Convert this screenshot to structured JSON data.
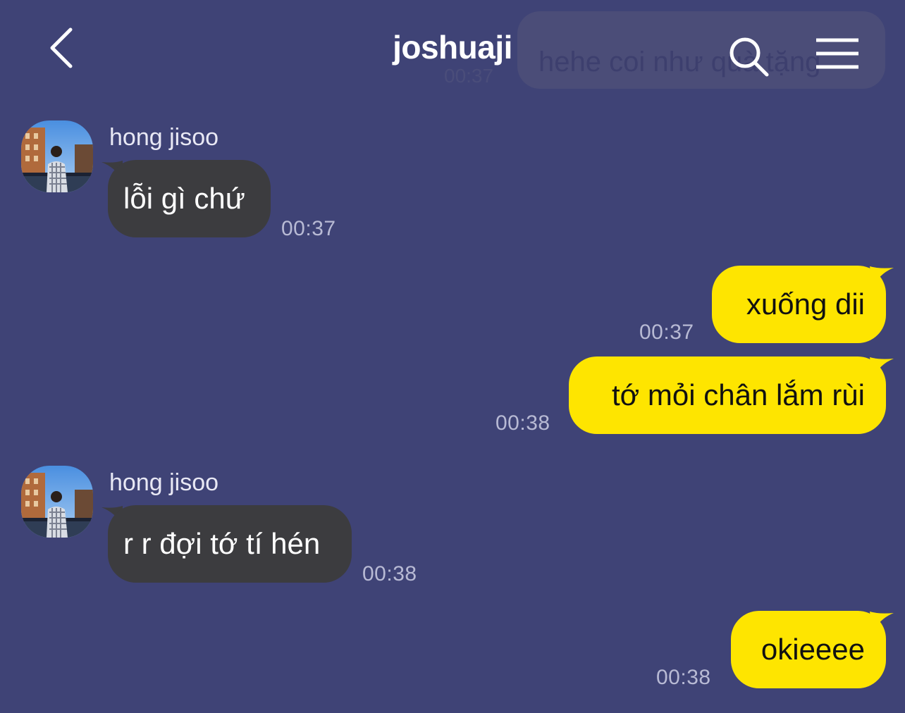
{
  "header": {
    "title": "joshuaji",
    "ghost_preview": {
      "text": "hehe coi như quà tặng",
      "time": "00:37"
    }
  },
  "colors": {
    "background": "#3f4376",
    "incoming_bubble": "#3c3c3f",
    "outgoing_bubble": "#fee500"
  },
  "icons": {
    "back": "chevron-left-icon",
    "search": "search-icon",
    "menu": "hamburger-menu-icon"
  },
  "messages": [
    {
      "sender": "hong jisoo",
      "text": "lỗi gì chứ",
      "time": "00:37",
      "direction": "incoming"
    },
    {
      "text": "xuống dii",
      "time": "00:37",
      "direction": "outgoing"
    },
    {
      "text": "tớ mỏi chân lắm rùi",
      "time": "00:38",
      "direction": "outgoing"
    },
    {
      "sender": "hong jisoo",
      "text": "r r đợi tớ tí hén",
      "time": "00:38",
      "direction": "incoming"
    },
    {
      "text": "okieeee",
      "time": "00:38",
      "direction": "outgoing"
    }
  ]
}
